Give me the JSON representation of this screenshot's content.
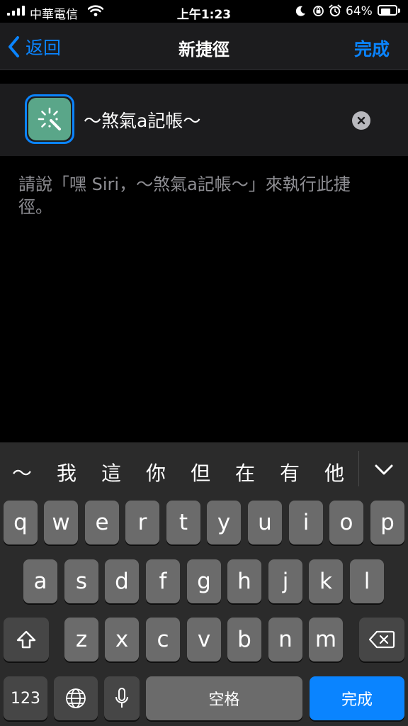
{
  "status_bar": {
    "carrier": "中華電信",
    "time": "上午1:23",
    "battery": "64%",
    "battery_level": 0.64
  },
  "nav": {
    "back_label": "返回",
    "title": "新捷徑",
    "done_label": "完成"
  },
  "shortcut": {
    "name": "～煞氣a記帳～",
    "icon": "magic-wand-icon",
    "icon_color": "#5aa689"
  },
  "hint": "請說「嘿 Siri，～煞氣a記帳～」來執行此捷徑。",
  "keyboard": {
    "candidates": [
      "～",
      "我",
      "這",
      "你",
      "但",
      "在",
      "有",
      "他"
    ],
    "row1": [
      "q",
      "w",
      "e",
      "r",
      "t",
      "y",
      "u",
      "i",
      "o",
      "p"
    ],
    "row2": [
      "a",
      "s",
      "d",
      "f",
      "g",
      "h",
      "j",
      "k",
      "l"
    ],
    "row3": [
      "z",
      "x",
      "c",
      "v",
      "b",
      "n",
      "m"
    ],
    "numbers_label": "123",
    "space_label": "空格",
    "return_label": "完成"
  },
  "colors": {
    "accent": "#0a84ff",
    "nav_background": "#1c1c1e",
    "keyboard_background": "#2b2b2b"
  }
}
